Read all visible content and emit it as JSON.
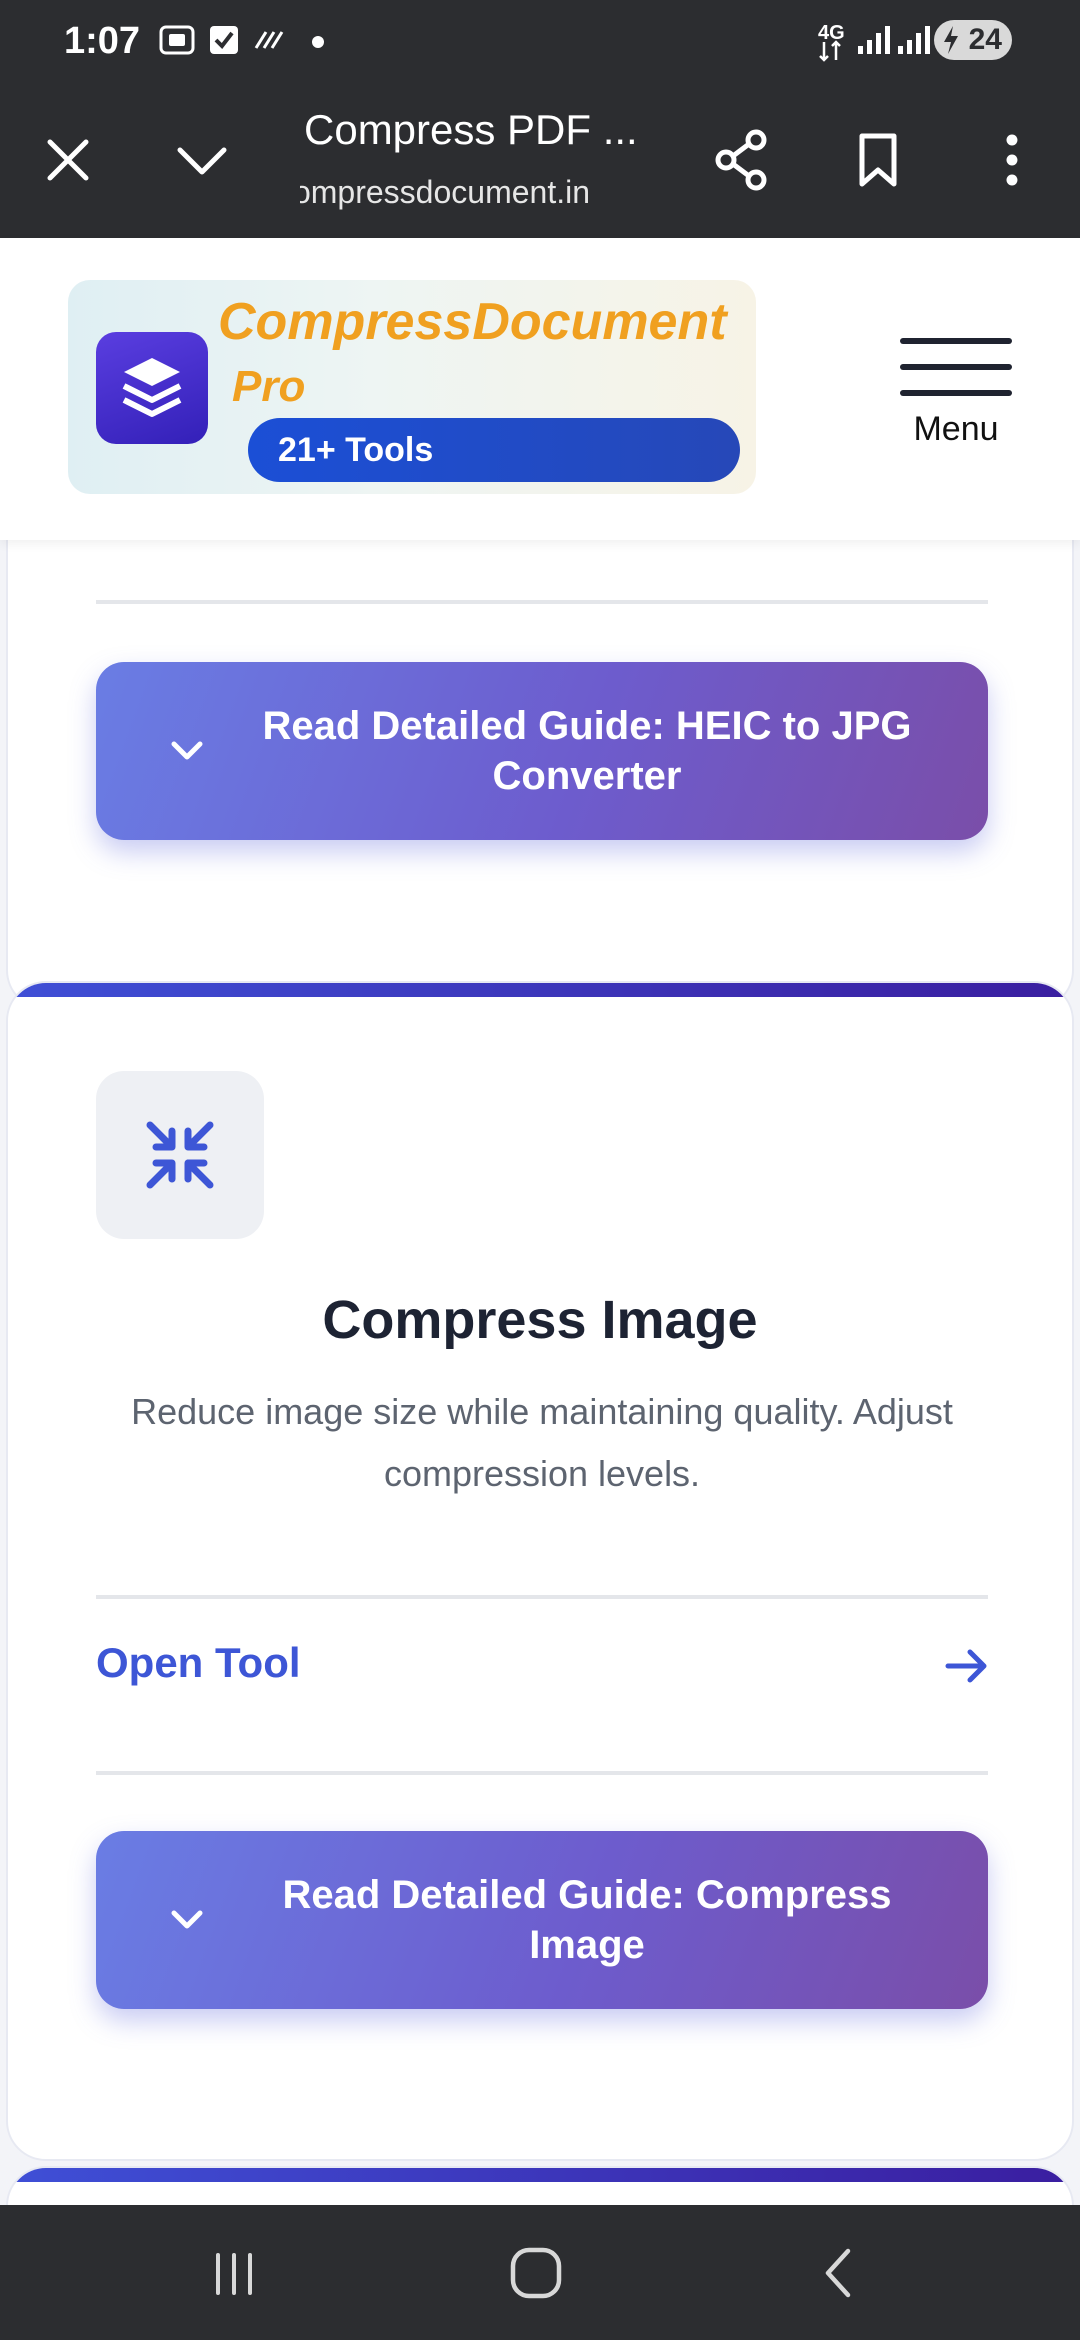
{
  "status_bar": {
    "time": "1:07",
    "network": "4G",
    "battery": "24"
  },
  "browser": {
    "title": "Compress PDF ...",
    "url": "compressdocument.in"
  },
  "site_header": {
    "logo_name": "CompressDocument",
    "logo_suffix": "Pro",
    "tools_badge": "21+ Tools",
    "menu_label": "Menu"
  },
  "cards": {
    "heic": {
      "guide_label": "Read Detailed Guide: HEIC to JPG Converter"
    },
    "compress_image": {
      "title": "Compress Image",
      "description": "Reduce image size while maintaining quality. Adjust compression levels.",
      "open_label": "Open Tool",
      "guide_label": "Read Detailed Guide: Compress Image"
    }
  },
  "colors": {
    "accent": "#3d56d6",
    "logo_orange": "#f0a020",
    "dark_bar": "#2c2d30"
  }
}
